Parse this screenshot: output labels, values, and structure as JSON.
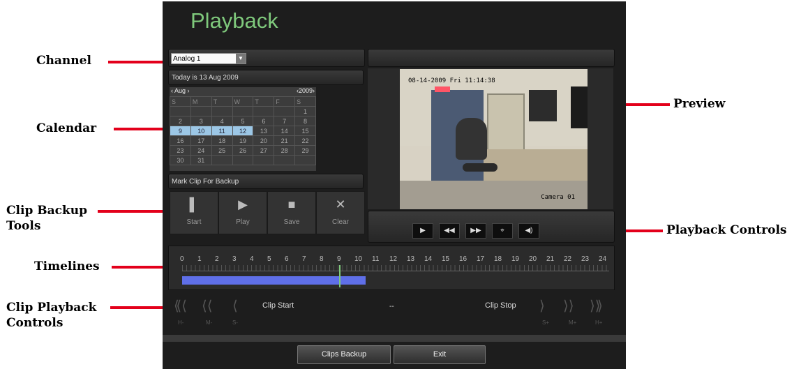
{
  "callouts": {
    "channel": "Channel",
    "calendar": "Calendar",
    "clip_backup_tools_1": "Clip Backup",
    "clip_backup_tools_2": "Tools",
    "timelines": "Timelines",
    "clip_playback_1": "Clip Playback",
    "clip_playback_2": "Controls",
    "preview": "Preview",
    "playback_controls": "Playback Controls"
  },
  "title": "Playback",
  "channel": {
    "selected": "Analog 1"
  },
  "today": "Today is 13 Aug 2009",
  "calendar": {
    "month": "‹ Aug ›",
    "year": "‹2009›",
    "day_headers": [
      "S",
      "M",
      "T",
      "W",
      "T",
      "F",
      "S"
    ],
    "weeks": [
      [
        "",
        "",
        "",
        "",
        "",
        "",
        "1"
      ],
      [
        "2",
        "3",
        "4",
        "5",
        "6",
        "7",
        "8"
      ],
      [
        "9",
        "10",
        "11",
        "12",
        "13",
        "14",
        "15"
      ],
      [
        "16",
        "17",
        "18",
        "19",
        "20",
        "21",
        "22"
      ],
      [
        "23",
        "24",
        "25",
        "26",
        "27",
        "28",
        "29"
      ],
      [
        "30",
        "31",
        "",
        "",
        "",
        "",
        ""
      ]
    ],
    "highlighted": [
      "9",
      "10",
      "11",
      "12"
    ]
  },
  "mark_clip": "Mark Clip For Backup",
  "clip_tools": [
    {
      "icon": "start-icon",
      "glyph": "▌",
      "label": "Start"
    },
    {
      "icon": "play-icon",
      "glyph": "▶",
      "label": "Play"
    },
    {
      "icon": "save-icon",
      "glyph": "■",
      "label": "Save"
    },
    {
      "icon": "clear-icon",
      "glyph": "✕",
      "label": "Clear"
    }
  ],
  "preview": {
    "osd_time": "08-14-2009 Fri 11:14:38",
    "camera": "Camera 01"
  },
  "playback_buttons": [
    {
      "icon": "play-icon",
      "glyph": "▶"
    },
    {
      "icon": "rewind-icon",
      "glyph": "◀◀"
    },
    {
      "icon": "fast-forward-icon",
      "glyph": "▶▶"
    },
    {
      "icon": "fullscreen-icon",
      "glyph": "⌖"
    },
    {
      "icon": "volume-icon",
      "glyph": "◀)"
    }
  ],
  "timeline": {
    "hours": [
      "0",
      "1",
      "2",
      "3",
      "4",
      "5",
      "6",
      "7",
      "8",
      "9",
      "10",
      "11",
      "12",
      "13",
      "14",
      "15",
      "16",
      "17",
      "18",
      "19",
      "20",
      "21",
      "22",
      "23",
      "24"
    ],
    "recorded_start_hour": 0,
    "recorded_end_hour": 10.5,
    "cursor_hour": 9,
    "colors": {
      "recorded": "#5f6fe8",
      "cursor": "#7fc97c"
    }
  },
  "clip_playback": {
    "left_labels": [
      "H-",
      "M-",
      "S-"
    ],
    "right_labels": [
      "S+",
      "M+",
      "H+"
    ],
    "clip_start": "Clip Start",
    "separator": "--",
    "clip_stop": "Clip Stop"
  },
  "footer": {
    "clips_backup": "Clips Backup",
    "exit": "Exit"
  },
  "colors": {
    "title": "#7fc97c",
    "callout_line": "#e3001b",
    "calendar_highlight": "#9cc7e6"
  }
}
